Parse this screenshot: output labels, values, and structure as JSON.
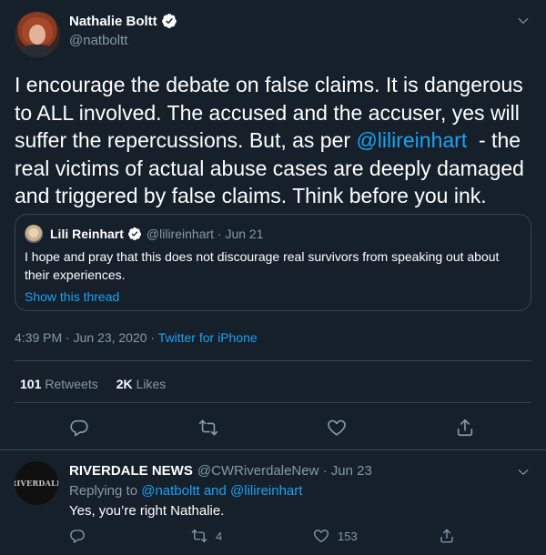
{
  "tweet": {
    "author_name": "Nathalie Boltt",
    "author_handle": "@natboltt",
    "text_before": "I encourage the debate on false claims. It is dangerous to ALL involved. The accused and the accuser, yes will suffer the repercussions. But, as per ",
    "mention": "@lilireinhart",
    "text_after": "  - the real victims of actual abuse cases are deeply damaged and triggered by false claims. Think before you ink.",
    "quote": {
      "author_name": "Lili Reinhart",
      "meta": "@lilireinhart · Jun 21",
      "text": "I hope and pray that this does not discourage real survivors from speaking out about their experiences.",
      "show_thread": "Show this thread"
    },
    "time": "4:39 PM · Jun 23, 2020 · ",
    "source": "Twitter for iPhone",
    "stats": {
      "retweets_count": "101",
      "retweets_label": "Retweets",
      "likes_count": "2K",
      "likes_label": "Likes"
    },
    "icons": [
      "reply-icon",
      "retweet-icon",
      "like-icon",
      "share-icon",
      "verified-badge-icon",
      "chevron-down-icon"
    ]
  },
  "reply": {
    "avatar_text": "RIVERDALE",
    "author_name": "RIVERDALE NEWS",
    "meta": "@CWRiverdaleNew · Jun 23",
    "replying_prefix": "Replying to ",
    "replying_mentions": "@natboltt and @lilireinhart",
    "text": "Yes, you’re right Nathalie.",
    "retweet_count": "4",
    "like_count": "153"
  },
  "colors": {
    "background": "#15202b",
    "accent": "#1da1f2",
    "secondary_text": "#8899a6",
    "border": "#38444d"
  }
}
